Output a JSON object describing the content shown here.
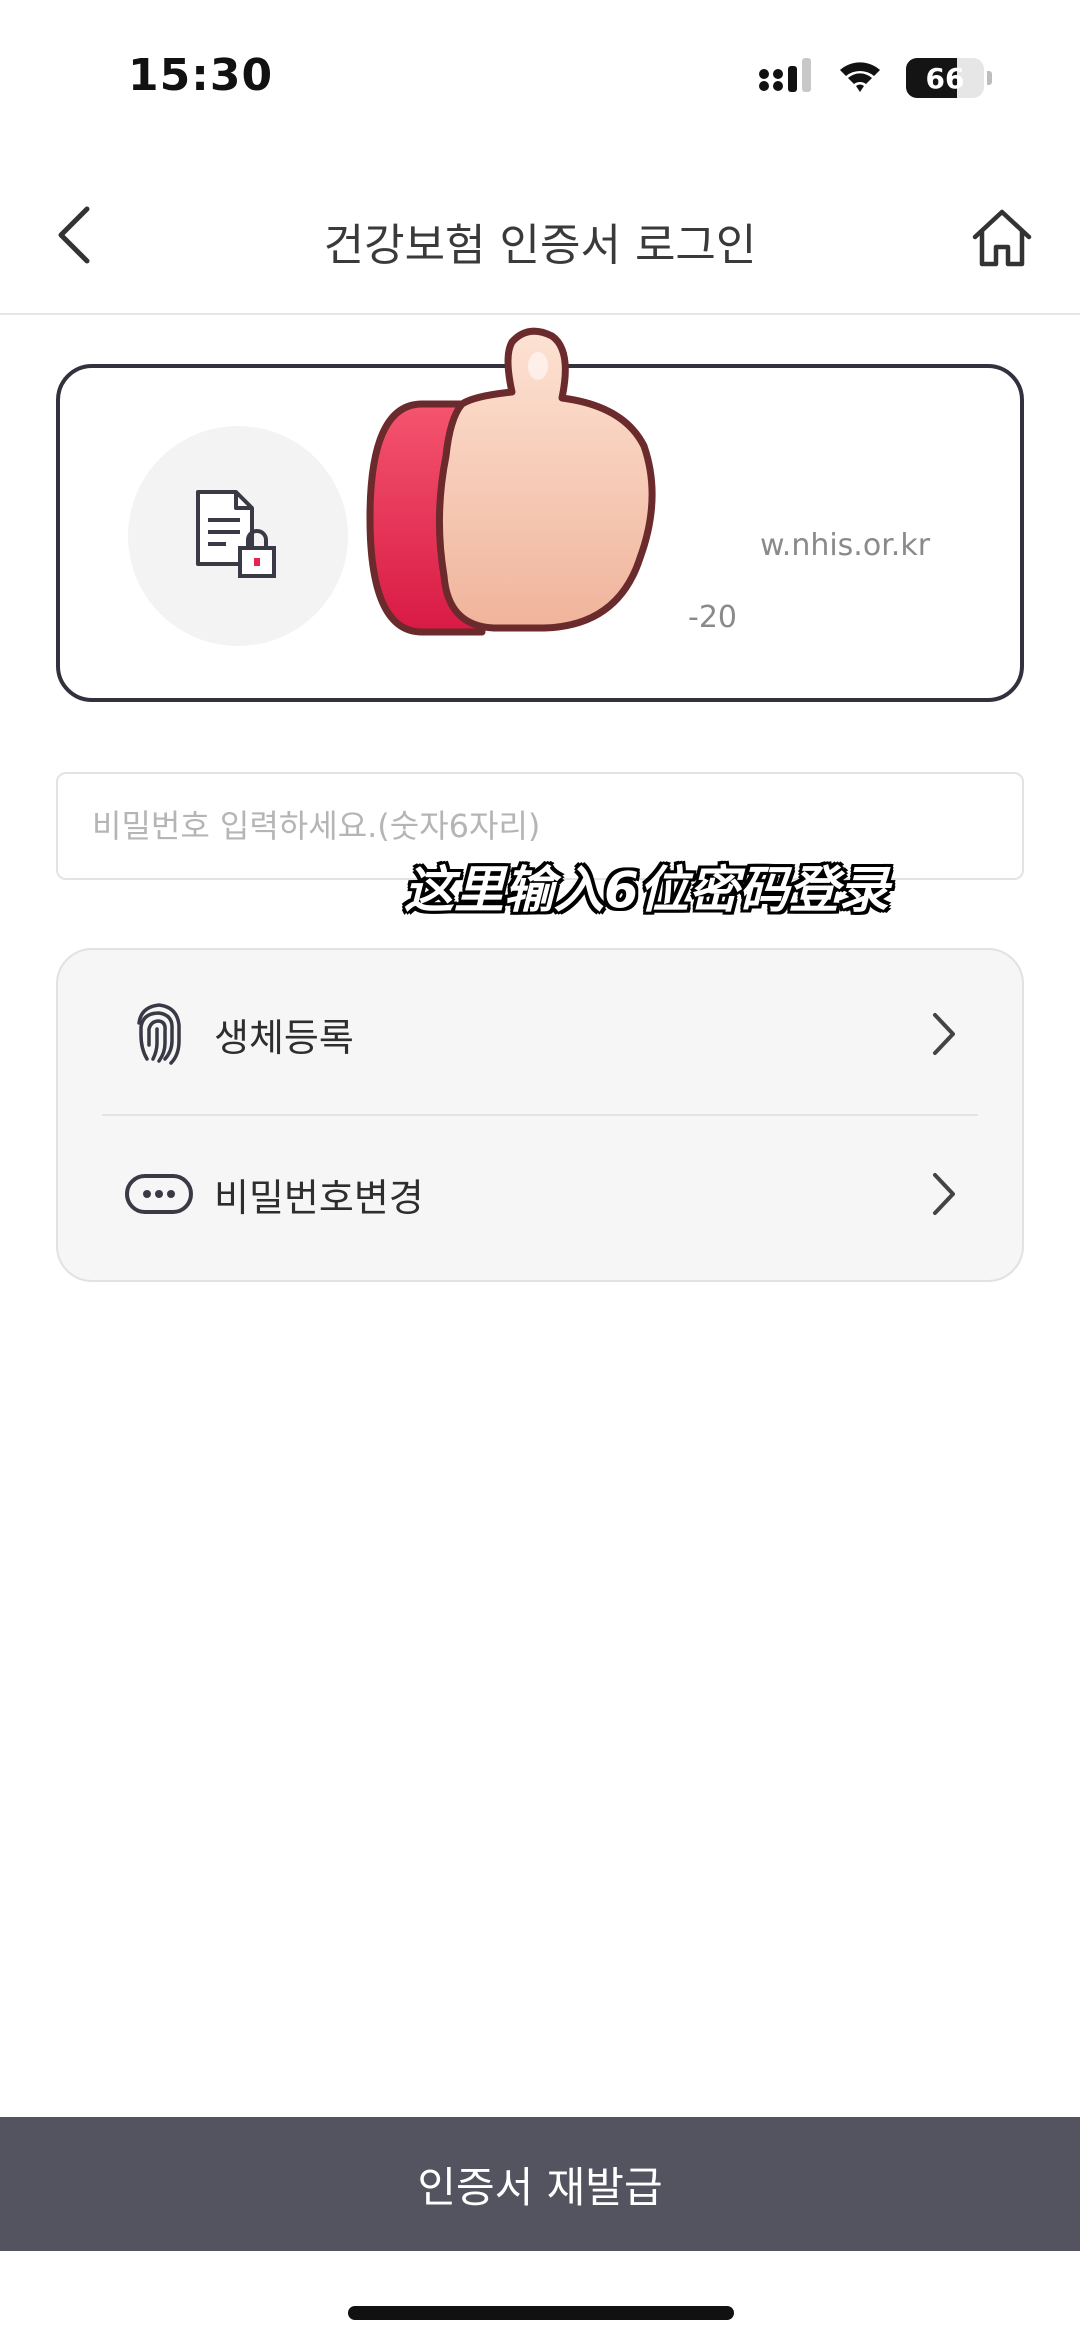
{
  "status_bar": {
    "time": "15:30",
    "battery_level": "66",
    "battery_fraction": 0.66,
    "icons": [
      "cellular-signal-icon",
      "wifi-icon",
      "battery-icon"
    ]
  },
  "header": {
    "title": "건강보험 인증서 로그인",
    "back_icon": "chevron-left-icon",
    "home_icon": "home-icon"
  },
  "certificate": {
    "icon": "document-lock-icon",
    "issuer_partial": "w.nhis.or.kr",
    "expiry_partial": "-20"
  },
  "password": {
    "placeholder": "비밀번호 입력하세요.(숫자6자리)",
    "value": ""
  },
  "overlay": {
    "caption": "这里输入6位密码登录",
    "sticker": "thumbs-up-sticker"
  },
  "menu": {
    "items": [
      {
        "label": "생체등록",
        "icon": "fingerprint-icon"
      },
      {
        "label": "비밀번호변경",
        "icon": "password-dots-icon"
      }
    ]
  },
  "footer": {
    "reissue_label": "인증서 재발급"
  },
  "colors": {
    "card_border": "#32323e",
    "button_bg": "#545360",
    "menu_bg": "#f6f6f6",
    "sticker_red": "#e8234f",
    "sticker_skin": "#f6cdb6"
  }
}
